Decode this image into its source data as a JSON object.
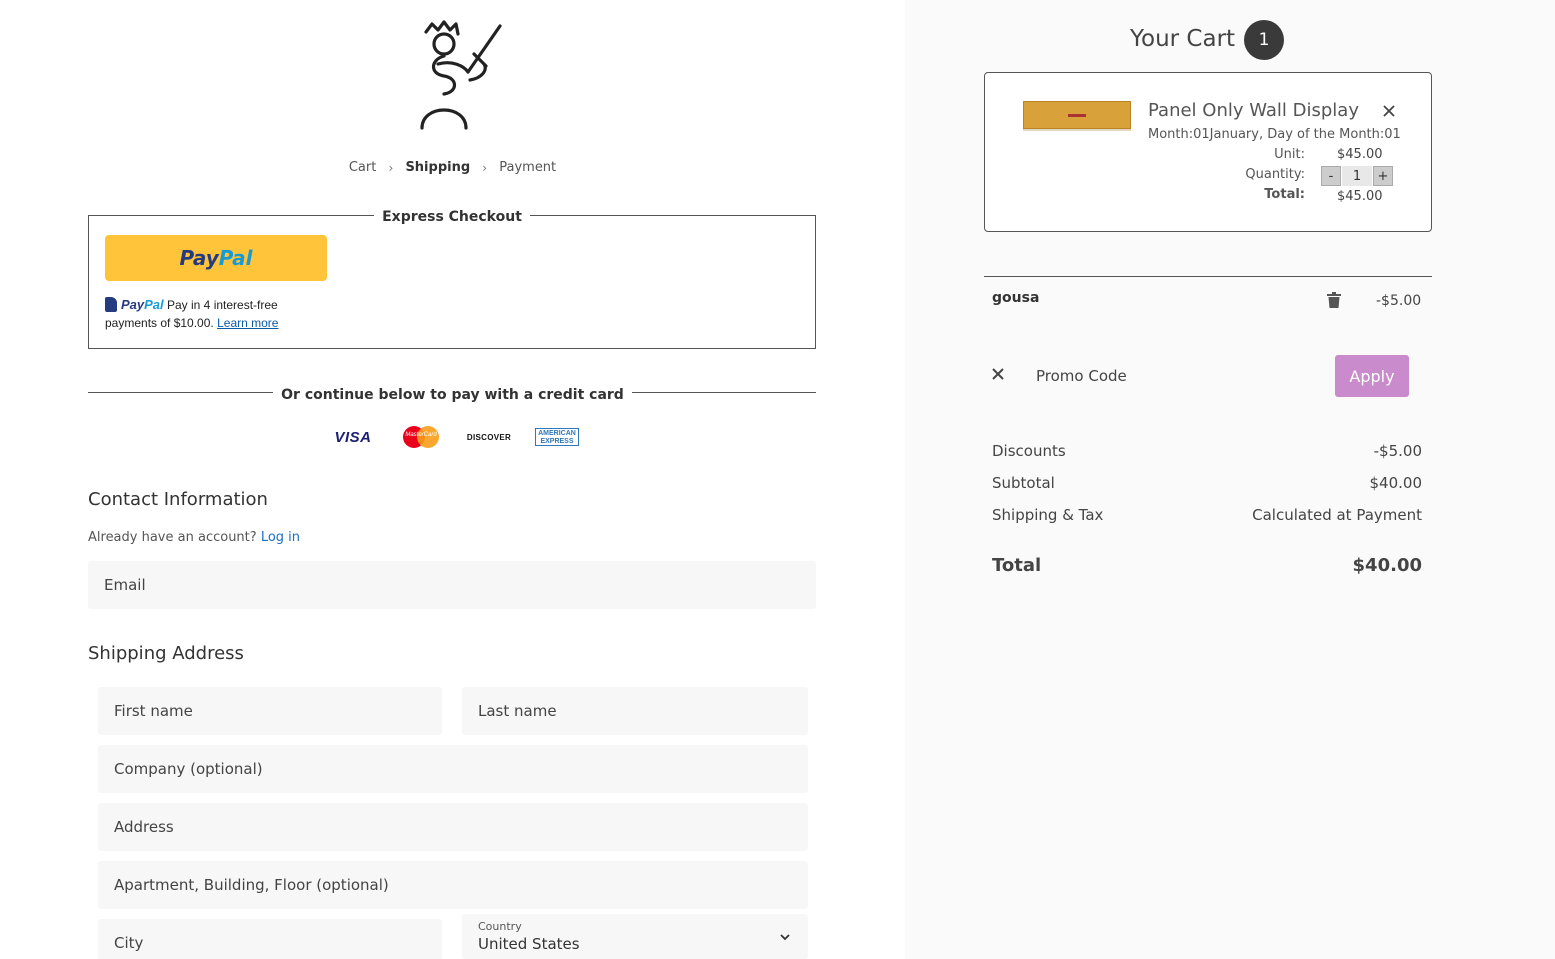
{
  "breadcrumb": {
    "cart": "Cart",
    "shipping": "Shipping",
    "payment": "Payment"
  },
  "express": {
    "legend": "Express Checkout",
    "paypal_a": "Pay",
    "paypal_b": "Pal",
    "paylater_text": "Pay in 4 interest-free payments of $10.00.",
    "learn_more": "Learn more"
  },
  "divider_text": "Or continue below to pay with a credit card",
  "cards": {
    "visa": "VISA",
    "mastercard": "MasterCard",
    "discover": "DISCOVER",
    "amex_1": "AMERICAN",
    "amex_2": "EXPRESS"
  },
  "contact": {
    "title": "Contact Information",
    "account_q": "Already have an account?",
    "login": "Log in",
    "email_placeholder": "Email"
  },
  "shipping": {
    "title": "Shipping Address",
    "first_name": "First name",
    "last_name": "Last name",
    "company": "Company (optional)",
    "address": "Address",
    "apartment": "Apartment, Building, Floor (optional)",
    "city": "City",
    "country_label": "Country",
    "country_value": "United States"
  },
  "cart": {
    "title": "Your Cart",
    "count": "1",
    "item": {
      "name": "Panel Only Wall Display",
      "meta": "Month:01January, Day of the Month:01",
      "unit_label": "Unit:",
      "unit_value": "$45.00",
      "qty_label": "Quantity:",
      "qty_minus": "-",
      "qty_value": "1",
      "qty_plus": "+",
      "total_label": "Total:",
      "total_value": "$45.00"
    },
    "code": {
      "name": "gousa",
      "amount": "-$5.00"
    },
    "promo_placeholder": "Promo Code",
    "apply": "Apply",
    "summary": {
      "discounts_label": "Discounts",
      "discounts_value": "-$5.00",
      "subtotal_label": "Subtotal",
      "subtotal_value": "$40.00",
      "shipping_label": "Shipping & Tax",
      "shipping_value": "Calculated at Payment",
      "total_label": "Total",
      "total_value": "$40.00"
    }
  },
  "colors": {
    "paypal_yellow": "#ffc439",
    "apply_purple": "#c98bcb",
    "link_blue": "#1a6fc4",
    "badge_dark": "#3a3a3a"
  }
}
